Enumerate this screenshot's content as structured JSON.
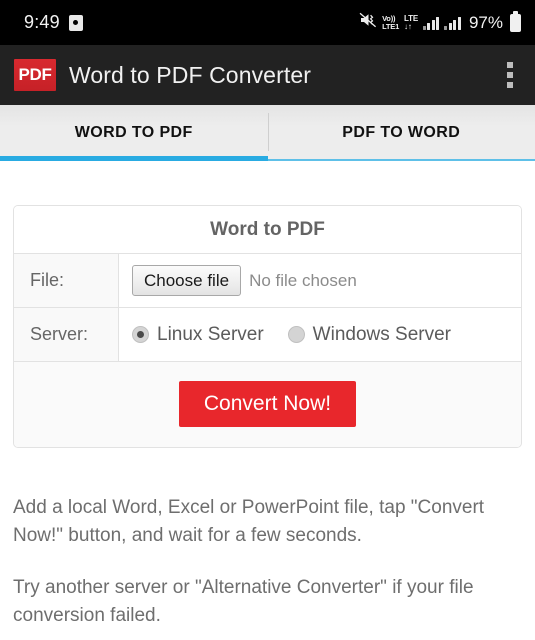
{
  "status_bar": {
    "time": "9:49",
    "alarm_icon": "alarm-clock-icon",
    "mute_icon": "mute-vibrate-icon",
    "volte_line1": "Vo))",
    "volte_line2": "LTE1",
    "lte_label": "LTE",
    "data_arrows": "↓↑",
    "battery_percent": "97%",
    "battery_icon": "battery-full-icon"
  },
  "app_bar": {
    "logo_text": "PDF",
    "title": "Word to PDF Converter",
    "overflow_icon": "overflow-menu-icon"
  },
  "tabs": [
    {
      "label": "WORD TO PDF",
      "active": true
    },
    {
      "label": "PDF TO WORD",
      "active": false
    }
  ],
  "panel": {
    "header": "Word to PDF",
    "file_row": {
      "label": "File:",
      "button_label": "Choose file",
      "status_text": "No file chosen"
    },
    "server_row": {
      "label": "Server:",
      "options": [
        {
          "label": "Linux Server",
          "selected": true
        },
        {
          "label": "Windows Server",
          "selected": false
        }
      ]
    },
    "submit_label": "Convert Now!"
  },
  "help": {
    "paragraph1": "Add a local Word, Excel or PowerPoint file, tap \"Convert Now!\" button, and wait for a few seconds.",
    "paragraph2": "Try another server or \"Alternative Converter\" if your file conversion failed."
  },
  "colors": {
    "accent_blue": "#29abe2",
    "brand_red": "#e8272c",
    "logo_red": "#d8292f",
    "app_bar_bg": "#222222",
    "status_bar_bg": "#000000"
  }
}
